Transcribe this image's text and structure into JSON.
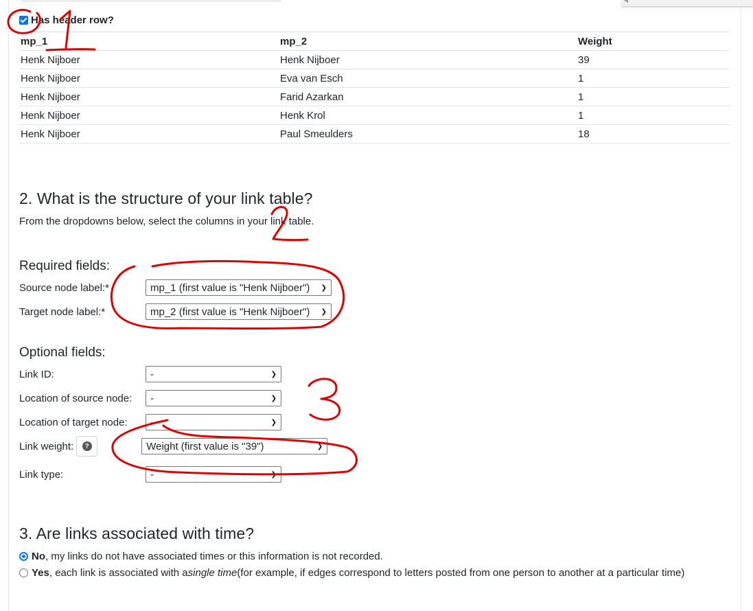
{
  "header_checkbox": {
    "label": "Has header row?",
    "checked": true
  },
  "preview_table": {
    "columns": [
      "mp_1",
      "mp_2",
      "Weight"
    ],
    "rows": [
      [
        "Henk Nijboer",
        "Henk Nijboer",
        "39"
      ],
      [
        "Henk Nijboer",
        "Eva van Esch",
        "1"
      ],
      [
        "Henk Nijboer",
        "Farid Azarkan",
        "1"
      ],
      [
        "Henk Nijboer",
        "Henk Krol",
        "1"
      ],
      [
        "Henk Nijboer",
        "Paul Smeulders",
        "18"
      ]
    ]
  },
  "section2": {
    "title": "2. What is the structure of your link table?",
    "description": "From the dropdowns below, select the columns in your link table.",
    "required_heading": "Required fields:",
    "required": [
      {
        "label": "Source node label:*",
        "value": "mp_1 (first value is \"Henk Nijboer\")"
      },
      {
        "label": "Target node label:*",
        "value": "mp_2 (first value is \"Henk Nijboer\")"
      }
    ],
    "optional_heading": "Optional fields:",
    "optional": [
      {
        "label": "Link ID:",
        "value": "-"
      },
      {
        "label": "Location of source node:",
        "value": "-"
      },
      {
        "label": "Location of target node:",
        "value": "-"
      },
      {
        "label": "Link weight:",
        "value": "Weight (first value is \"39\")"
      },
      {
        "label": "Link type:",
        "value": "-"
      }
    ]
  },
  "section3": {
    "title": "3. Are links associated with time?",
    "options": [
      {
        "bold": "No",
        "text": ", my links do not have associated times or this information is not recorded.",
        "selected": true
      },
      {
        "bold": "Yes",
        "text_before": ", each link is associated with a ",
        "italic": "single time",
        "text_after": " (for example, if edges correspond to letters posted from one person to another at a particular time)",
        "selected": false
      }
    ]
  },
  "colors": {
    "accent": "#0075ff",
    "annotation": "#e00000"
  },
  "icons": {
    "help": "question-circle-icon",
    "dropdown": "chevron-down-icon",
    "check": "check-icon"
  }
}
